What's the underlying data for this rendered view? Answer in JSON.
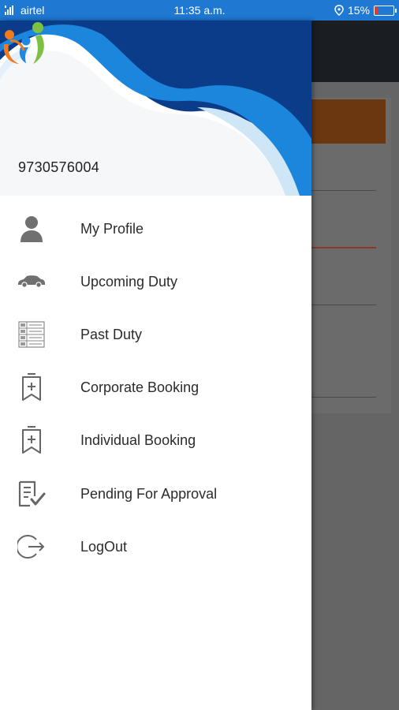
{
  "status_bar": {
    "carrier": "airtel",
    "time": "11:35 a.m.",
    "battery": "15%",
    "battery_level": 0.15
  },
  "drawer": {
    "phone_number": "9730576004",
    "menu": [
      {
        "label": "My Profile",
        "icon": "person-icon"
      },
      {
        "label": "Upcoming Duty",
        "icon": "car-icon"
      },
      {
        "label": "Past Duty",
        "icon": "checklist-grid-icon"
      },
      {
        "label": "Corporate Booking",
        "icon": "bookmark-add-icon"
      },
      {
        "label": "Individual Booking",
        "icon": "bookmark-add-icon"
      },
      {
        "label": "Pending For Approval",
        "icon": "document-check-icon"
      },
      {
        "label": "LogOut",
        "icon": "logout-icon"
      }
    ]
  },
  "colors": {
    "status_bar": "#1f78d1",
    "header_dark_blue": "#0a3f8f",
    "header_blue": "#1a7fd6",
    "header_light": "#cfe6f7",
    "icon_gray": "#6b6b6b"
  }
}
